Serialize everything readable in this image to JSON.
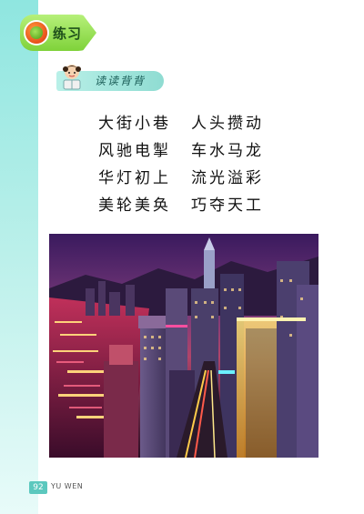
{
  "header": {
    "section_title": "练习"
  },
  "subheading": {
    "label": "读读背背"
  },
  "poem": {
    "rows": [
      [
        "大街小巷",
        "人头攒动"
      ],
      [
        "风驰电掣",
        "车水马龙"
      ],
      [
        "华灯初上",
        "流光溢彩"
      ],
      [
        "美轮美奂",
        "巧夺天工"
      ]
    ]
  },
  "footer": {
    "page_number": "92",
    "label": "YU WEN"
  },
  "colors": {
    "side_band": "#8fe6e0",
    "pill_green": "#7fd23a",
    "banner_teal": "#8fdcd2"
  }
}
